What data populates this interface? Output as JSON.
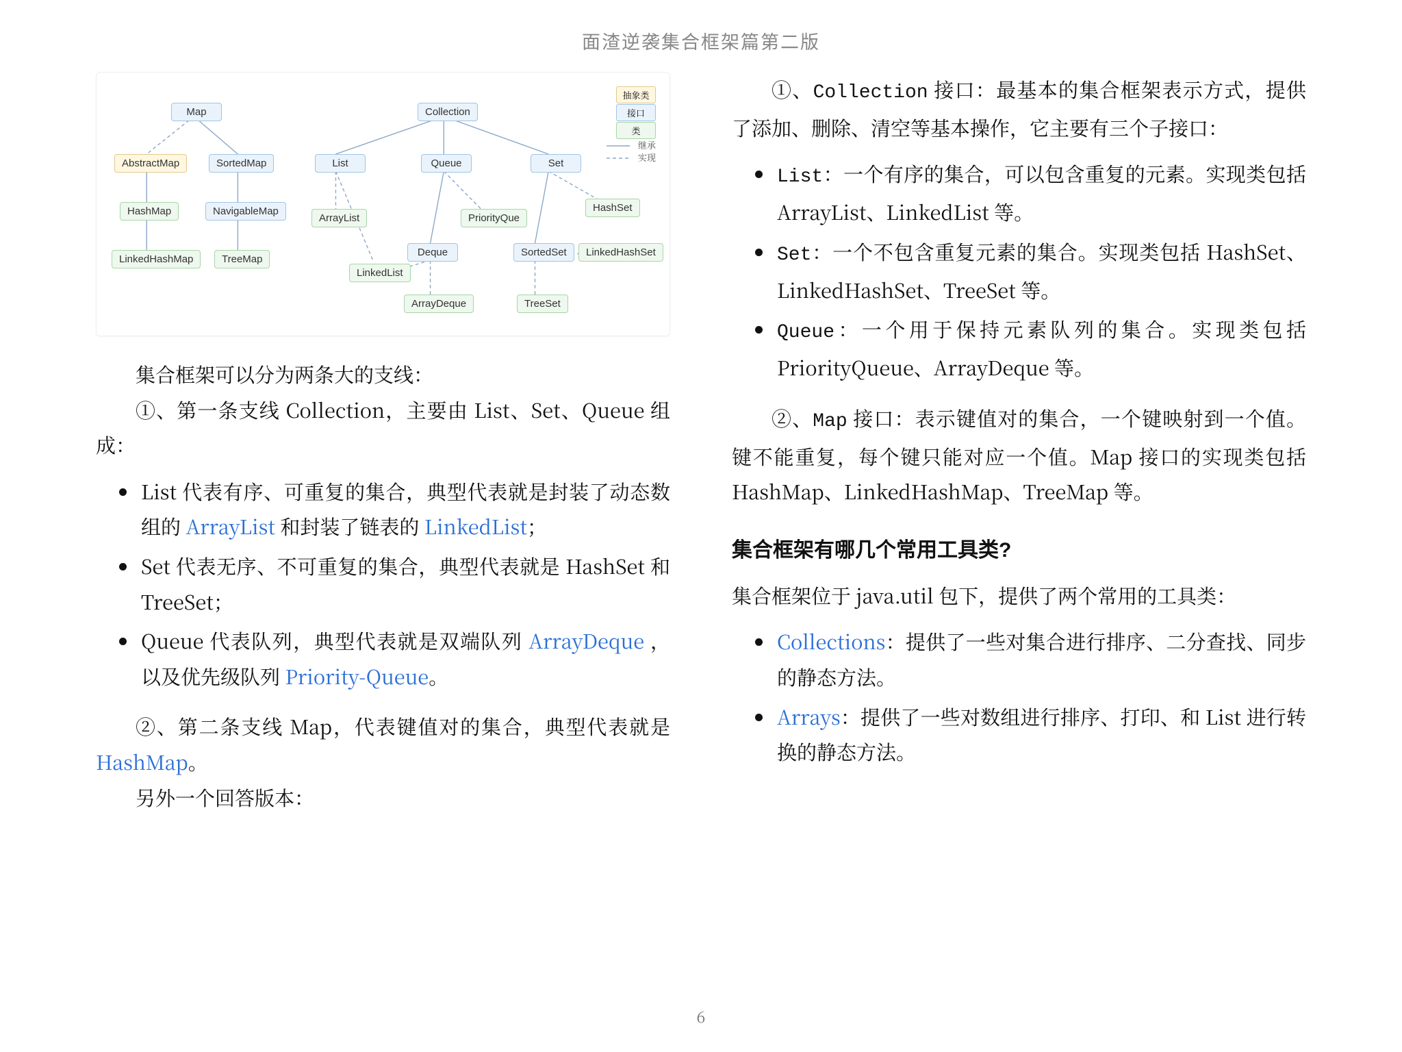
{
  "header": "面渣逆袭集合框架篇第二版",
  "pagenum": "6",
  "diagram": {
    "nodes": {
      "map": "Map",
      "collection": "Collection",
      "abstractmap": "AbstractMap",
      "sortedmap": "SortedMap",
      "list": "List",
      "queue": "Queue",
      "set": "Set",
      "hashmap": "HashMap",
      "navigablemap": "NavigableMap",
      "arraylist": "ArrayList",
      "priorityque": "PriorityQue",
      "hashset": "HashSet",
      "linkedhashmap": "LinkedHashMap",
      "treemap": "TreeMap",
      "deque": "Deque",
      "sortedset": "SortedSet",
      "linkedhashset": "LinkedHashSet",
      "linkedlist": "LinkedList",
      "arraydeque": "ArrayDeque",
      "treeset": "TreeSet"
    },
    "legend": {
      "abs": "抽象类",
      "iface": "接口",
      "cls": "类",
      "inherit": "继承",
      "impl": "实现"
    }
  },
  "left": {
    "intro": "集合框架可以分为两条大的支线：",
    "line1_a": "①、第一条支线 Collection，主要由 List、Set、Queue 组成：",
    "b1_a": "List 代表有序、可重复的集合，典型代表就是封装了动态数组的 ",
    "b1_link1": "ArrayList",
    "b1_mid": " 和封装了链表的 ",
    "b1_link2": "LinkedList",
    "b1_tail": "；",
    "b2": "Set 代表无序、不可重复的集合，典型代表就是 HashSet 和 TreeSet；",
    "b3_a": "Queue 代表队列，典型代表就是双端队列 ",
    "b3_link1": "ArrayDeque",
    "b3_mid": " ，以及优先级队列 ",
    "b3_link2": "Priority-Queue",
    "b3_tail": "。",
    "line2_a": "②、第二条支线 Map，代表键值对的集合，典型代表就是 ",
    "line2_link": "HashMap",
    "line2_tail": "。",
    "line3": "另外一个回答版本："
  },
  "right": {
    "p1_a": "①、",
    "p1_code": "Collection",
    "p1_b": " 接口：最基本的集合框架表示方式，提供了添加、删除、清空等基本操作，它主要有三个子接口：",
    "li1_code": "List",
    "li1_b": "：一个有序的集合，可以包含重复的元素。实现类包括 ArrayList、LinkedList 等。",
    "li2_code": "Set",
    "li2_b": "：一个不包含重复元素的集合。实现类包括 HashSet、LinkedHashSet、TreeSet 等。",
    "li3_code": "Queue",
    "li3_b": "：一个用于保持元素队列的集合。实现类包括 PriorityQueue、ArrayDeque 等。",
    "p2_a": "②、",
    "p2_code": "Map",
    "p2_b": " 接口：表示键值对的集合，一个键映射到一个值。键不能重复，每个键只能对应一个值。Map 接口的实现类包括 HashMap、LinkedHashMap、TreeMap 等。",
    "h3": "集合框架有哪几个常用工具类?",
    "p3": "集合框架位于 java.util 包下，提供了两个常用的工具类：",
    "u1_link": "Collections",
    "u1_b": "：提供了一些对集合进行排序、二分查找、同步的静态方法。",
    "u2_link": "Arrays",
    "u2_b": "：提供了一些对数组进行排序、打印、和 List 进行转换的静态方法。"
  }
}
